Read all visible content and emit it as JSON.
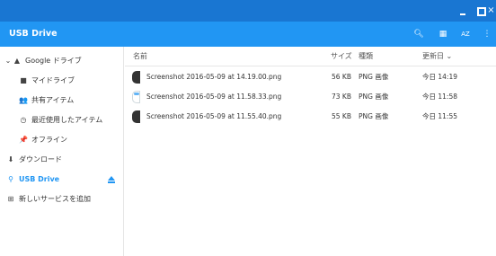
{
  "window": {
    "minimize_glyph": "",
    "maximize_glyph": "",
    "close_glyph": "×"
  },
  "appbar": {
    "title": "USB Drive",
    "icons": [
      "search-icon",
      "grid-view-icon",
      "sort-icon",
      "more-icon"
    ],
    "sort_glyph": "AZ",
    "more_glyph": "⋮",
    "search_glyph": "🔍︎",
    "grid_glyph": "▦"
  },
  "sidebar": {
    "items": [
      {
        "label": "Google ドライブ",
        "glyph": "▲",
        "expander": "⌄",
        "icon": "google-drive-icon"
      },
      {
        "label": "マイドライブ",
        "glyph": "■",
        "icon": "my-drive-icon"
      },
      {
        "label": "共有アイテム",
        "glyph": "👥",
        "icon": "shared-icon"
      },
      {
        "label": "最近使用したアイテム",
        "glyph": "◷",
        "icon": "recent-icon"
      },
      {
        "label": "オフライン",
        "glyph": "📌",
        "icon": "offline-pin-icon"
      },
      {
        "label": "ダウンロード",
        "glyph": "⬇",
        "icon": "download-icon"
      },
      {
        "label": "USB Drive",
        "glyph": "⚲",
        "icon": "usb-icon",
        "active": true
      },
      {
        "label": "新しいサービスを追加",
        "glyph": "⊞",
        "icon": "add-service-icon"
      }
    ]
  },
  "table": {
    "headers": {
      "name": "名前",
      "size": "サイズ",
      "type": "種類",
      "modified": "更新日 ⌄"
    },
    "rows": [
      {
        "name": "Screenshot 2016-05-09 at 14.19.00.png",
        "size": "56 KB",
        "type": "PNG 画像",
        "modified": "今日 14:19",
        "thumb": "dark"
      },
      {
        "name": "Screenshot 2016-05-09 at 11.58.33.png",
        "size": "73 KB",
        "type": "PNG 画像",
        "modified": "今日 11:58",
        "thumb": "light"
      },
      {
        "name": "Screenshot 2016-05-09 at 11.55.40.png",
        "size": "55 KB",
        "type": "PNG 画像",
        "modified": "今日 11:55",
        "thumb": "dark"
      }
    ]
  },
  "colors": {
    "titlebar": "#1976d2",
    "appbar": "#2196f3",
    "accent": "#2196f3"
  }
}
